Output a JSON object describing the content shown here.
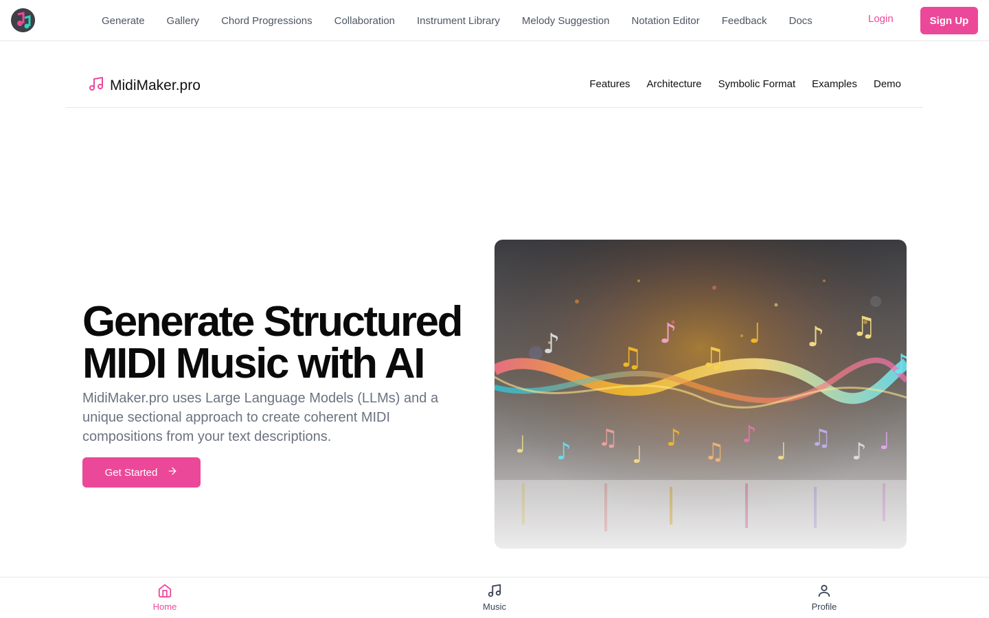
{
  "topnav": {
    "items": [
      "Generate",
      "Gallery",
      "Chord Progressions",
      "Collaboration",
      "Instrument Library",
      "Melody Suggestion",
      "Notation Editor",
      "Feedback",
      "Docs"
    ],
    "login_label": "Login",
    "signup_label": "Sign Up"
  },
  "site_header": {
    "brand": "MidiMaker.pro",
    "nav": [
      "Features",
      "Architecture",
      "Symbolic Format",
      "Examples",
      "Demo"
    ]
  },
  "hero": {
    "title_line1": "Generate Structured",
    "title_line2": "MIDI Music with AI",
    "subtitle": "MidiMaker.pro uses Large Language Models (LLMs) and a unique sectional approach to create coherent MIDI compositions from your text descriptions.",
    "cta_label": "Get Started",
    "cta_icon": "arrow-right-icon",
    "image_icon": "music-notes-wave-illustration"
  },
  "bottom_tabs": [
    {
      "label": "Home",
      "icon": "home-icon",
      "active": true
    },
    {
      "label": "Music",
      "icon": "music-note-icon",
      "active": false
    },
    {
      "label": "Profile",
      "icon": "user-icon",
      "active": false
    }
  ],
  "colors": {
    "accent": "#ec4899",
    "text_muted": "#6b7280",
    "border": "#e5e7eb"
  }
}
